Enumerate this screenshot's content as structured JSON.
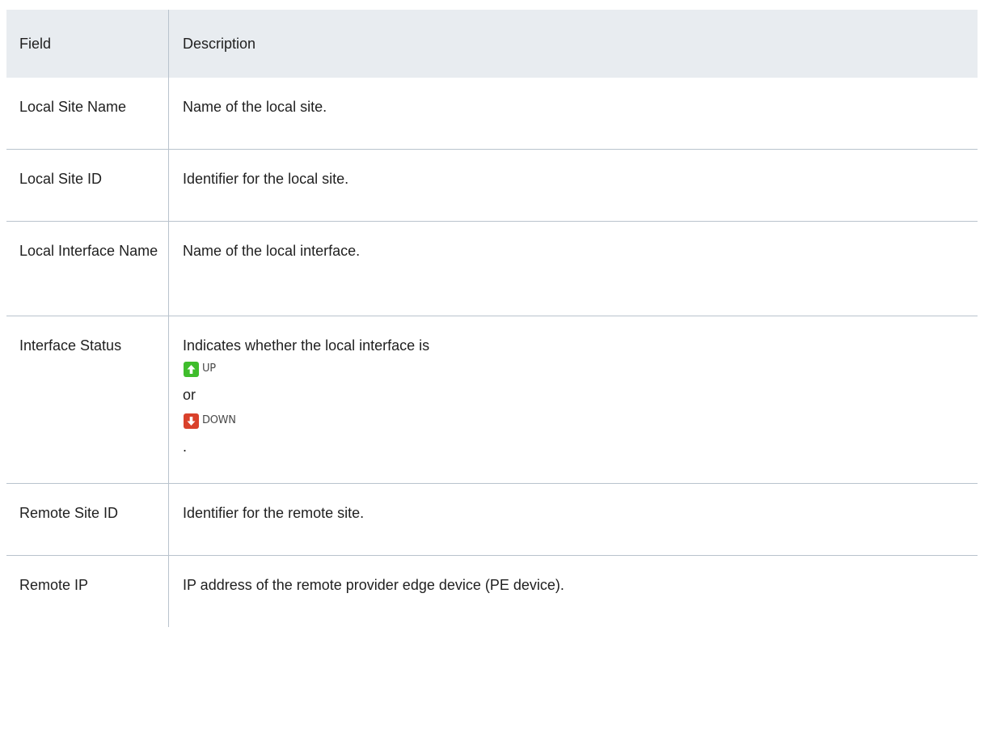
{
  "header": {
    "field": "Field",
    "description": "Description"
  },
  "rows": [
    {
      "field": "Local Site Name",
      "description": "Name of the local site."
    },
    {
      "field": "Local Site ID",
      "description": "Identifier for the local site."
    },
    {
      "field": "Local Interface Name",
      "description": "Name of the local interface."
    },
    {
      "field": "Interface Status",
      "description": "Indicates whether the local interface is",
      "status_up": {
        "label": "UP",
        "icon": "arrow-up-icon",
        "color": "#3fbd2c"
      },
      "or_text": "or",
      "status_down": {
        "label": "DOWN",
        "icon": "arrow-down-icon",
        "color": "#d9412b"
      },
      "trailing": "."
    },
    {
      "field": "Remote Site ID",
      "description": "Identifier for the remote site."
    },
    {
      "field": "Remote IP",
      "description": "IP address of the remote provider edge device (PE device)."
    }
  ]
}
